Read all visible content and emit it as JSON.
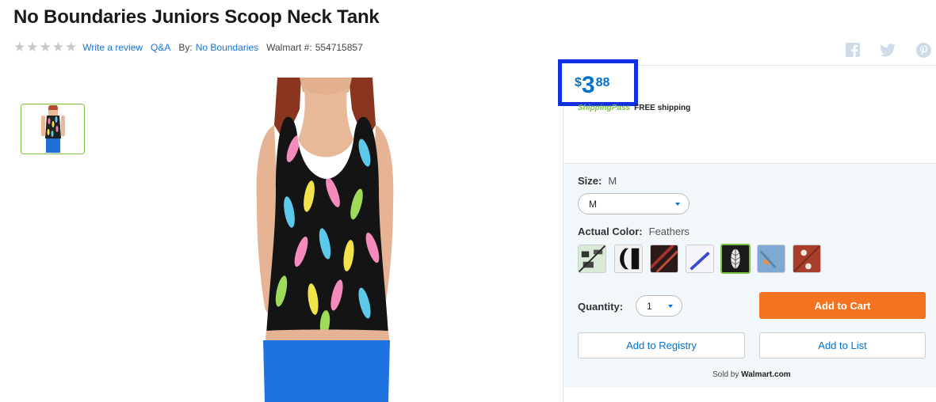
{
  "product": {
    "title": "No Boundaries Juniors Scoop Neck Tank",
    "rating_stars": 0,
    "write_review": "Write a review",
    "qa": "Q&A",
    "by_label": "By:",
    "brand": "No Boundaries",
    "walmart_label": "Walmart #:",
    "walmart_number": "554715857"
  },
  "share": {
    "icons": [
      "facebook-icon",
      "twitter-icon",
      "pinterest-icon"
    ],
    "color": "#d0dae6"
  },
  "price": {
    "currency": "$",
    "whole": "3",
    "cents": "88",
    "color": "#0071ce",
    "highlight_color": "#1030e0"
  },
  "shipping": {
    "pass": "ShippingPass",
    "text": "FREE shipping"
  },
  "size": {
    "label": "Size:",
    "value": "M",
    "selected": "M"
  },
  "color": {
    "label": "Actual Color:",
    "value": "Feathers",
    "swatches": [
      "swatch-1",
      "swatch-2",
      "swatch-3",
      "swatch-4",
      "swatch-feathers",
      "swatch-6",
      "swatch-7"
    ],
    "selected_index": 4
  },
  "quantity": {
    "label": "Quantity:",
    "value": "1"
  },
  "buttons": {
    "add_to_cart": "Add to Cart",
    "add_to_registry": "Add to Registry",
    "add_to_list": "Add to List",
    "cart_color": "#f47321"
  },
  "sold_by": {
    "label": "Sold by",
    "seller": "Walmart.com"
  }
}
